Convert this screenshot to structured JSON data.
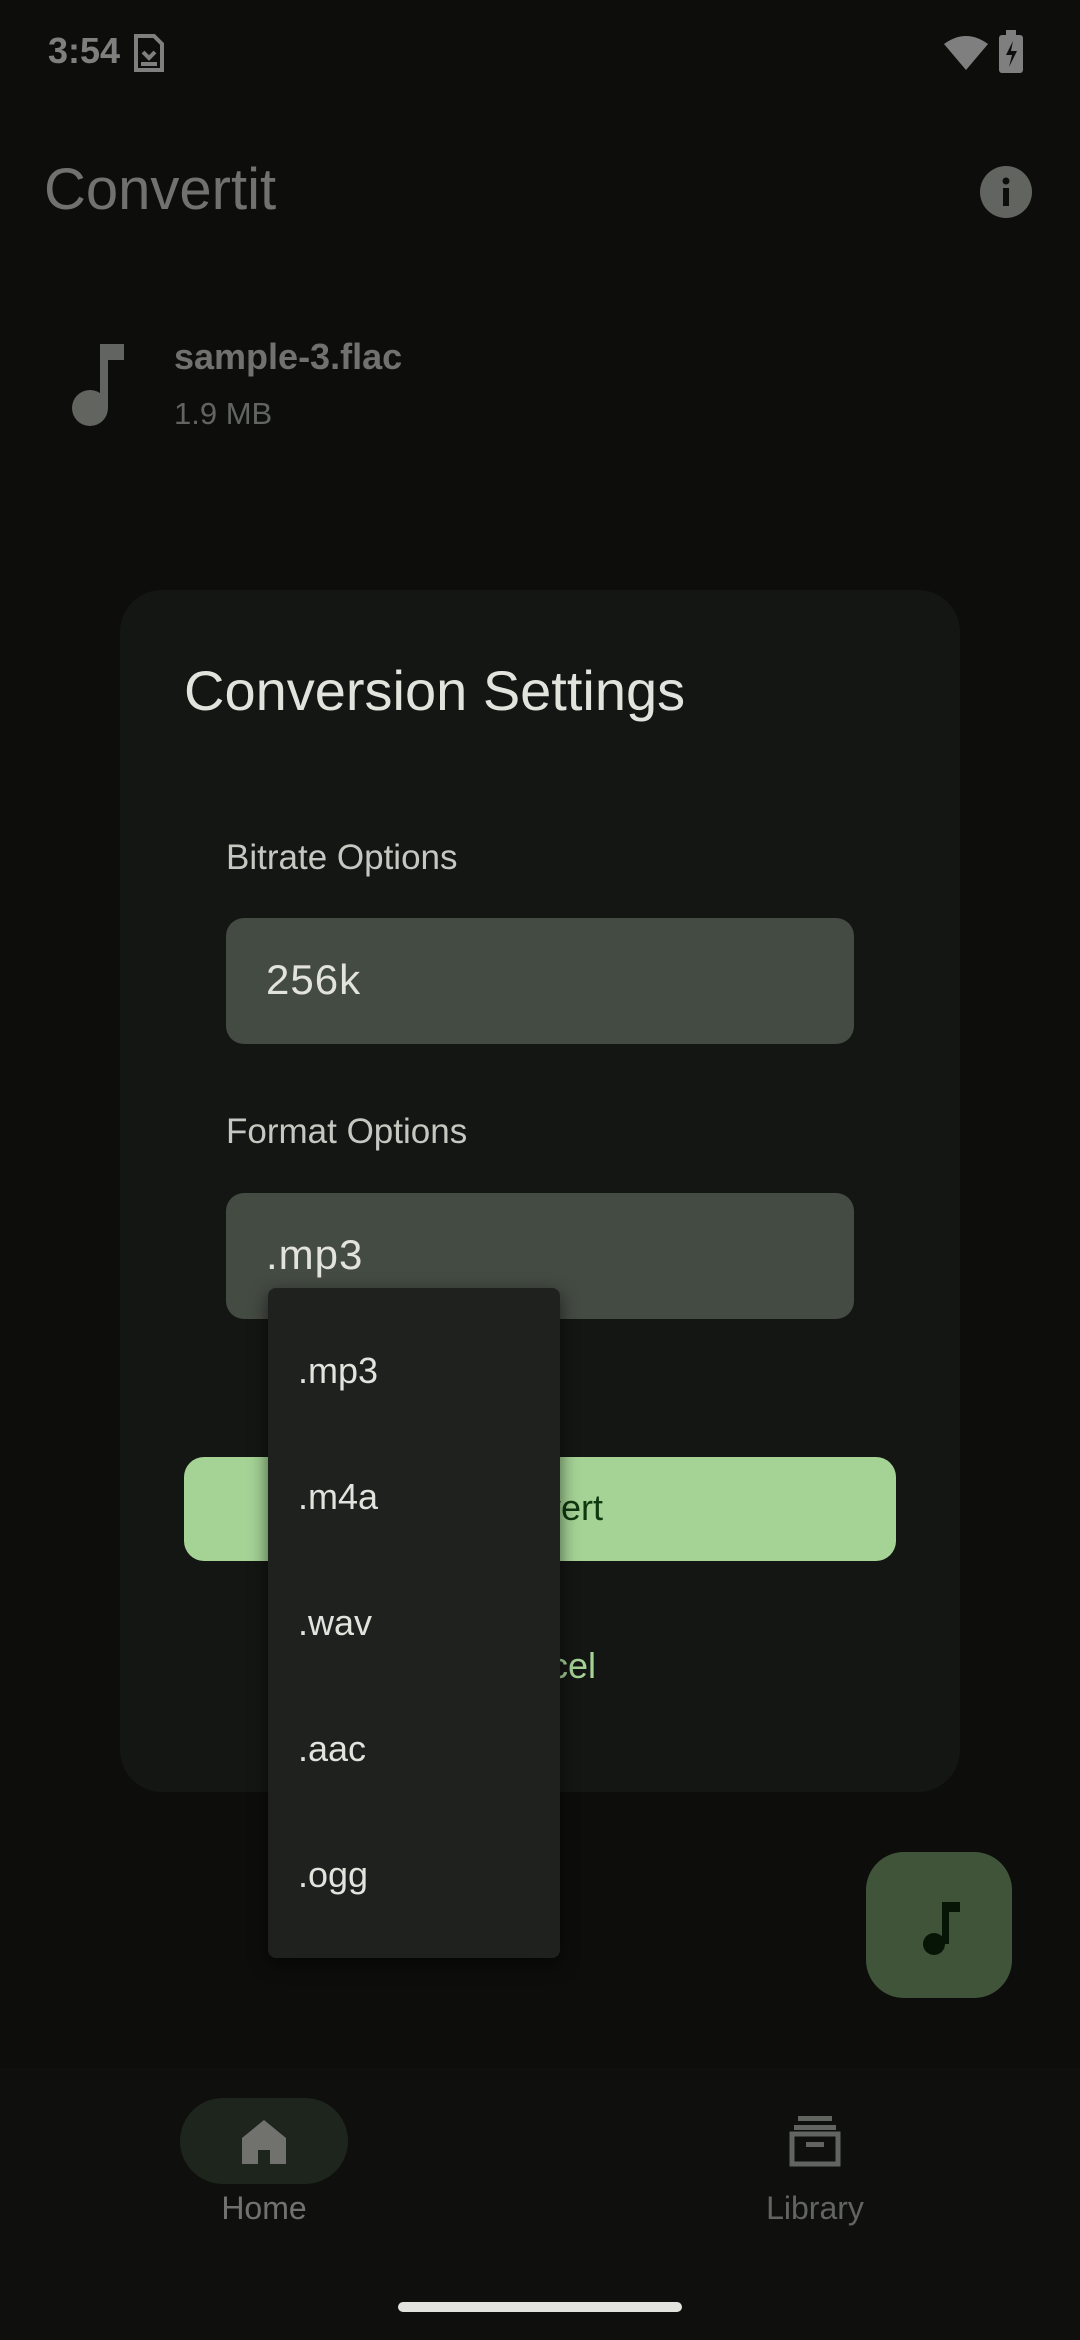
{
  "status_bar": {
    "time": "3:54"
  },
  "app_bar": {
    "title": "Convertit",
    "info_icon": "info-icon"
  },
  "file": {
    "name": "sample-3.flac",
    "size": "1.9 MB",
    "icon": "music-note-icon"
  },
  "dialog": {
    "title": "Conversion Settings",
    "bitrate_label": "Bitrate Options",
    "bitrate_value": "256k",
    "format_label": "Format Options",
    "format_value": ".mp3",
    "convert_label": "Convert",
    "cancel_label": "Cancel"
  },
  "format_menu": {
    "options": [
      ".mp3",
      ".m4a",
      ".wav",
      ".aac",
      ".ogg"
    ]
  },
  "bottom_nav": {
    "items": [
      {
        "label": "Home",
        "icon": "home-icon",
        "selected": true
      },
      {
        "label": "Library",
        "icon": "library-icon",
        "selected": false
      }
    ]
  },
  "colors": {
    "background": "#1a1c19",
    "accent": "#a5d396",
    "field": "#444b43",
    "fab": "#80a874"
  }
}
